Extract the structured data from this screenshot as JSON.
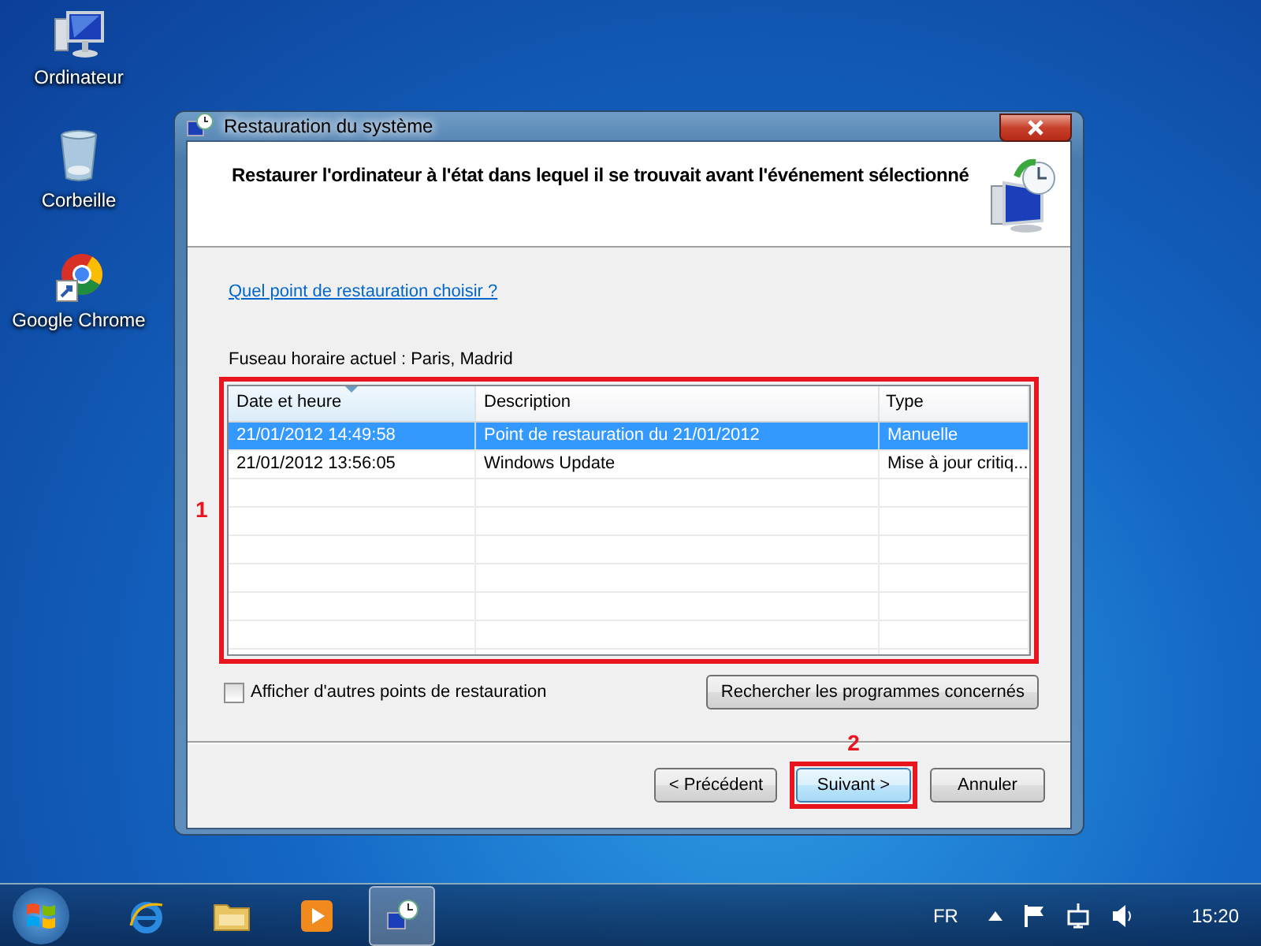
{
  "desktop_icons": [
    {
      "label": "Ordinateur",
      "kind": "computer"
    },
    {
      "label": "Corbeille",
      "kind": "bin"
    },
    {
      "label": "Google Chrome",
      "kind": "chrome"
    }
  ],
  "window": {
    "title": "Restauration du système",
    "heading": "Restaurer l'ordinateur à l'état dans lequel il se trouvait avant l'événement sélectionné",
    "help_link": "Quel point de restauration choisir ?",
    "timezone": "Fuseau horaire actuel : Paris, Madrid",
    "table": {
      "annotation": "1",
      "columns": [
        "Date et heure",
        "Description",
        "Type"
      ],
      "rows": [
        {
          "cells": [
            "21/01/2012 14:49:58",
            "Point de restauration du 21/01/2012",
            "Manuelle"
          ],
          "selected": true
        },
        {
          "cells": [
            "21/01/2012 13:56:05",
            "Windows Update",
            "Mise à jour critiq..."
          ],
          "selected": false
        }
      ]
    },
    "show_more": {
      "label": "Afficher d'autres points de restauration",
      "checked": false
    },
    "scan_button": "Rechercher les programmes concernés",
    "buttons": [
      {
        "label": "< Précédent"
      },
      {
        "label": "Suivant >",
        "annotation": "2"
      },
      {
        "label": "Annuler"
      }
    ]
  },
  "taskbar": {
    "apps": [
      {
        "kind": "ie",
        "active": false
      },
      {
        "kind": "folder",
        "active": false
      },
      {
        "kind": "media",
        "active": false
      },
      {
        "kind": "restore",
        "active": true
      }
    ],
    "language": "FR",
    "clock": "15:20"
  }
}
